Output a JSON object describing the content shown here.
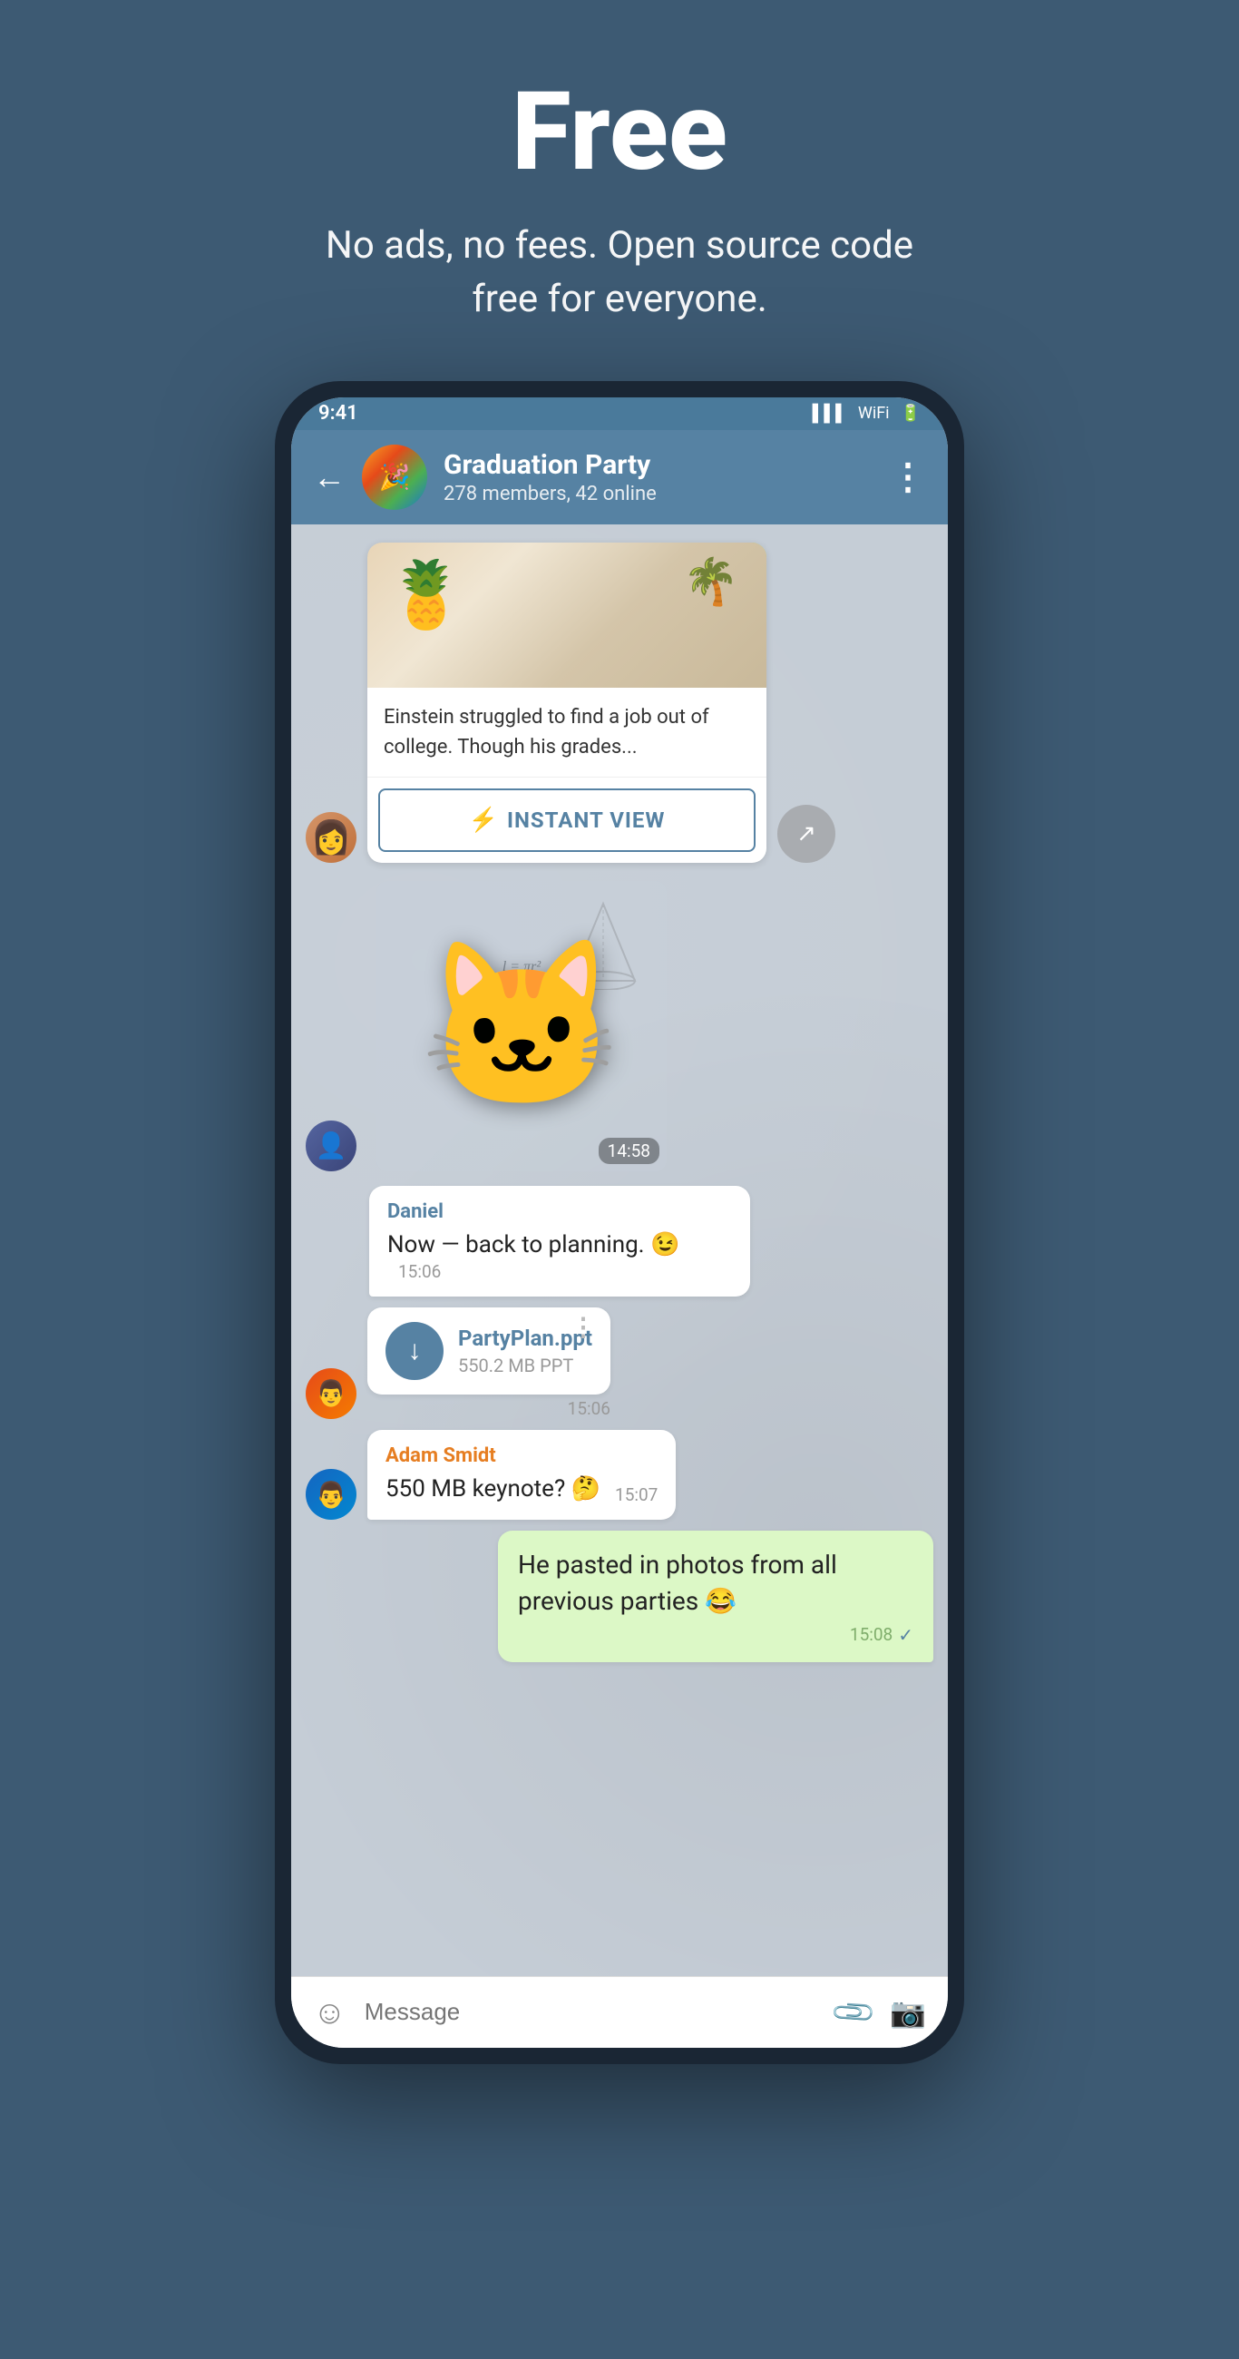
{
  "hero": {
    "title": "Free",
    "subtitle": "No ads, no fees. Open source code free for everyone."
  },
  "phone": {
    "header": {
      "back_label": "←",
      "chat_name": "Graduation Party",
      "chat_members": "278 members, 42 online",
      "more_icon": "⋮"
    },
    "article": {
      "preview_text": "Einstein struggled to find a job out of college. Though his grades...",
      "instant_view_label": "INSTANT VIEW"
    },
    "sticker": {
      "time": "14:58"
    },
    "messages": [
      {
        "sender": "Daniel",
        "text": "Now — back to planning. 😉",
        "time": "15:06"
      }
    ],
    "file": {
      "name": "PartyPlan.ppt",
      "size": "550.2 MB PPT",
      "time": "15:06"
    },
    "adam": {
      "sender": "Adam Smidt",
      "text": "550 MB keynote? 🤔",
      "time": "15:07"
    },
    "own_message": {
      "text": "He pasted in photos from all previous parties 😂",
      "time": "15:08"
    },
    "input": {
      "placeholder": "Message"
    }
  },
  "colors": {
    "telegram_blue": "#5682a3",
    "telegram_dark": "#3d5a73",
    "green_bubble": "#dcf8c6",
    "white_bubble": "#ffffff"
  }
}
